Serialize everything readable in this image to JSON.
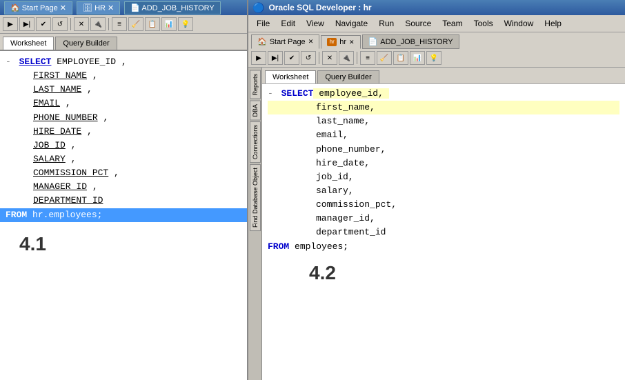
{
  "left": {
    "titlebar": {
      "icon": "db",
      "tab1": "Start Page",
      "tab2": "HR",
      "tab3": "ADD_JOB_HISTORY"
    },
    "tabs": {
      "worksheet": "Worksheet",
      "querybuilder": "Query Builder"
    },
    "sql": {
      "select_kw": "SELECT",
      "fields": [
        "EMPLOYEE_ID ,",
        "FIRST_NAME ,",
        "LAST_NAME ,",
        "EMAIL ,",
        "PHONE_NUMBER ,",
        "HIRE_DATE ,",
        "JOB_ID ,",
        "SALARY ,",
        "COMMISSION_PCT ,",
        "MANAGER_ID ,",
        "DEPARTMENT_ID"
      ],
      "from_kw": "FROM",
      "from_table": "hr.employees;",
      "version": "4.1"
    }
  },
  "right": {
    "titlebar": "Oracle SQL Developer : hr",
    "menu": [
      "File",
      "Edit",
      "View",
      "Navigate",
      "Run",
      "Source",
      "Team",
      "Tools",
      "Window",
      "Help"
    ],
    "tabs": {
      "startpage": "Start Page",
      "hr": "hr",
      "addjobhistory": "ADD_JOB_HISTORY"
    },
    "sidetabs": [
      "Reports",
      "DBA",
      "Connections",
      "Find Database Object"
    ],
    "innertabs": {
      "worksheet": "Worksheet",
      "querybuilder": "Query Builder"
    },
    "sql": {
      "select_kw": "SELECT",
      "fields": [
        "employee_id,",
        "first_name,",
        "last_name,",
        "email,",
        "phone_number,",
        "hire_date,",
        "job_id,",
        "salary,",
        "commission_pct,",
        "manager_id,",
        "department_id"
      ],
      "from_kw": "FROM",
      "from_table": "employees;",
      "version": "4.2"
    }
  }
}
